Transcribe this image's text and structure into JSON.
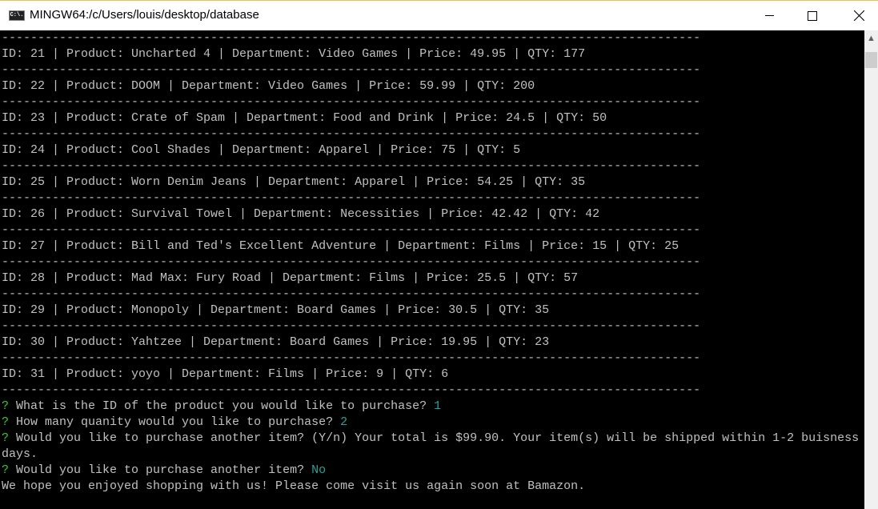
{
  "window": {
    "title": "MINGW64:/c/Users/louis/desktop/database",
    "icon": "terminal-icon",
    "icon_text": "C:\\."
  },
  "colors": {
    "prompt": "#3ec43e",
    "answer": "#2aa198",
    "text": "#c0c0c0",
    "background": "#000000"
  },
  "separator": "-------------------------------------------------------------------------------------------------",
  "products": [
    {
      "text": "ID: 21 | Product: Uncharted 4 | Department: Video Games | Price: 49.95 | QTY: 177"
    },
    {
      "text": "ID: 22 | Product: DOOM | Department: Video Games | Price: 59.99 | QTY: 200"
    },
    {
      "text": "ID: 23 | Product: Crate of Spam | Department: Food and Drink | Price: 24.5 | QTY: 50"
    },
    {
      "text": "ID: 24 | Product: Cool Shades | Department: Apparel | Price: 75 | QTY: 5"
    },
    {
      "text": "ID: 25 | Product: Worn Denim Jeans | Department: Apparel | Price: 54.25 | QTY: 35"
    },
    {
      "text": "ID: 26 | Product: Survival Towel | Department: Necessities | Price: 42.42 | QTY: 42"
    },
    {
      "text": "ID: 27 | Product: Bill and Ted's Excellent Adventure | Department: Films | Price: 15 | QTY: 25"
    },
    {
      "text": "ID: 28 | Product: Mad Max: Fury Road | Department: Films | Price: 25.5 | QTY: 57"
    },
    {
      "text": "ID: 29 | Product: Monopoly | Department: Board Games | Price: 30.5 | QTY: 35"
    },
    {
      "text": "ID: 30 | Product: Yahtzee | Department: Board Games | Price: 19.95 | QTY: 23"
    },
    {
      "text": "ID: 31 | Product: yoyo | Department: Films | Price: 9 | QTY: 6"
    }
  ],
  "prompts": {
    "mark": "?",
    "q1": " What is the ID of the product you would like to purchase? ",
    "a1": "1",
    "q2": " How many quanity would you like to purchase? ",
    "a2": "2",
    "q3": " Would you like to purchase another item? (Y/n) Your total is $99.90. Your item(s) will be shipped within 1-2 buisness",
    "q3_wrap": "days.",
    "q4": " Would you like to purchase another item? ",
    "a4": "No",
    "farewell": "We hope you enjoyed shopping with us! Please come visit us again soon at Bamazon."
  }
}
